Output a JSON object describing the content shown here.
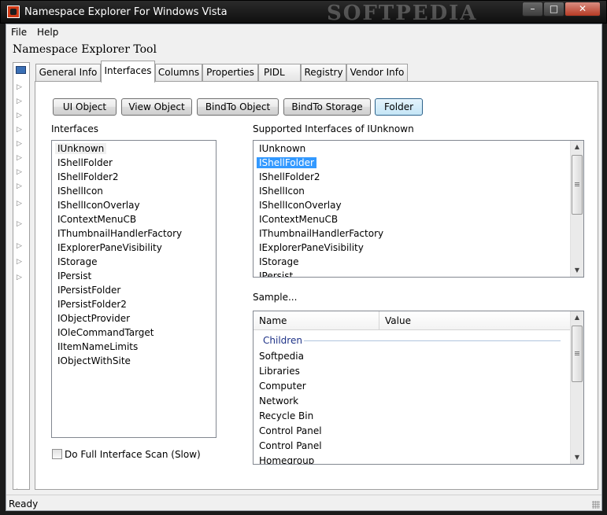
{
  "window": {
    "title": "Namespace Explorer For Windows Vista",
    "watermark": "SOFTPEDIA",
    "controls": {
      "minimize": "–",
      "maximize": "□",
      "close": "✕"
    }
  },
  "menu": [
    "File",
    "Help"
  ],
  "heading": "Namespace Explorer Tool",
  "tabs": [
    "General Info",
    "Interfaces",
    "Columns",
    "Properties",
    "PIDL",
    "Registry",
    "Vendor Info"
  ],
  "active_tab": "Interfaces",
  "buttons": [
    "UI Object",
    "View Object",
    "BindTo Object",
    "BindTo Storage",
    "Folder"
  ],
  "interfaces_panel": {
    "label": "Interfaces",
    "items": [
      "IUnknown",
      "IShellFolder",
      "IShellFolder2",
      "IShellIcon",
      "IShellIconOverlay",
      "IContextMenuCB",
      "IThumbnailHandlerFactory",
      "IExplorerPaneVisibility",
      "IStorage",
      "IPersist",
      "IPersistFolder",
      "IPersistFolder2",
      "IObjectProvider",
      "IOleCommandTarget",
      "IItemNameLimits",
      "IObjectWithSite"
    ]
  },
  "supported_panel": {
    "label": "Supported Interfaces of IUnknown",
    "selected": "IShellFolder",
    "items": [
      "IUnknown",
      "IShellFolder",
      "IShellFolder2",
      "IShellIcon",
      "IShellIconOverlay",
      "IContextMenuCB",
      "IThumbnailHandlerFactory",
      "IExplorerPaneVisibility",
      "IStorage",
      "IPersist"
    ]
  },
  "sample_panel": {
    "label": "Sample...",
    "columns": [
      "Name",
      "Value"
    ],
    "group": "Children",
    "items": [
      "Softpedia",
      "Libraries",
      "Computer",
      "Network",
      "Recycle Bin",
      "Control Panel",
      "Control Panel",
      "Homegroup"
    ]
  },
  "full_scan_checkbox": {
    "label": "Do Full Interface Scan (Slow)",
    "checked": false
  },
  "status": "Ready",
  "colors": {
    "selection": "#3399ff",
    "group_header": "#1e3287"
  },
  "icons": [
    "app-icon",
    "scroll-up-icon",
    "scroll-down-icon",
    "size-grip-icon",
    "tree-expand-icon"
  ]
}
